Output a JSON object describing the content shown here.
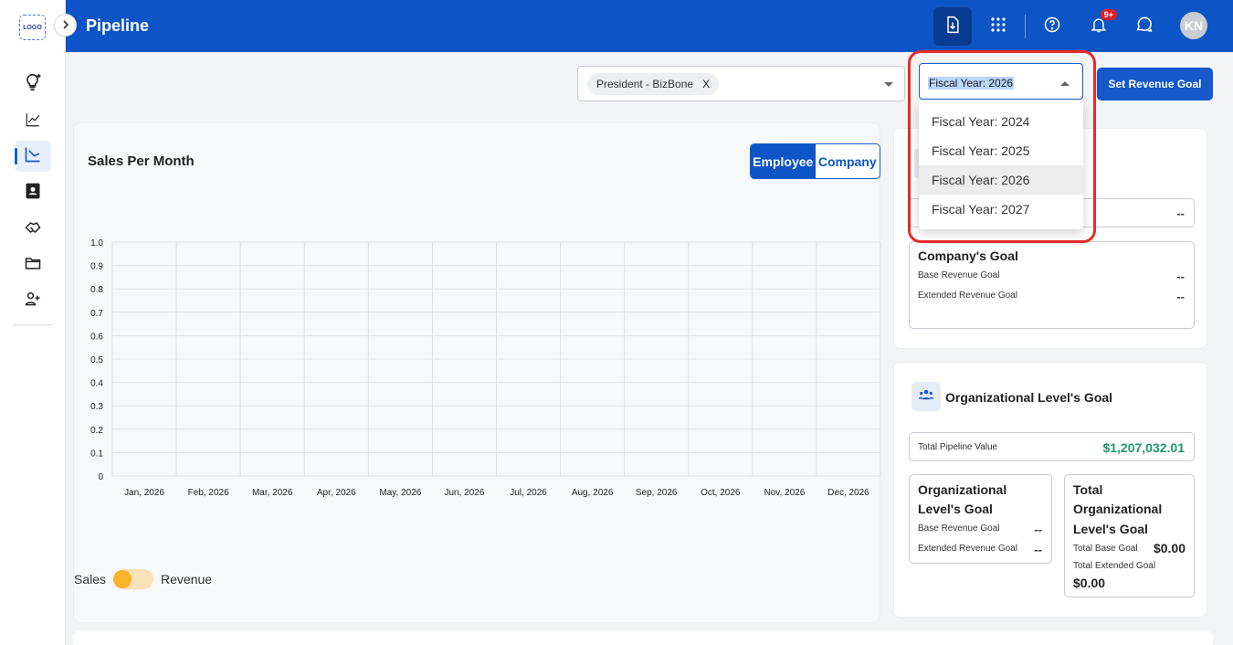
{
  "sidebar": {
    "logo_text": "LOGO",
    "items": [
      {
        "icon": "lightbulb-icon"
      },
      {
        "icon": "trend-line-icon"
      },
      {
        "icon": "pipeline-chart-icon",
        "active": true
      },
      {
        "icon": "contact-book-icon"
      },
      {
        "icon": "handshake-icon"
      },
      {
        "icon": "folder-icon"
      },
      {
        "icon": "add-user-icon"
      }
    ]
  },
  "header": {
    "title": "Pipeline",
    "notification_badge": "9+",
    "avatar_initials": "KN"
  },
  "filters": {
    "selected_chip": "President - BizBone",
    "chip_remove": "X",
    "fiscal_year_value": "Fiscal Year: 2026",
    "set_goal_label": "Set Revenue Goal"
  },
  "fiscal_dropdown": {
    "options": [
      "Fiscal Year: 2024",
      "Fiscal Year: 2025",
      "Fiscal Year: 2026",
      "Fiscal Year: 2027"
    ],
    "selected": "Fiscal Year: 2026"
  },
  "chart_card": {
    "title": "Sales Per Month",
    "view_tabs": [
      "Employee",
      "Company"
    ],
    "active_tab": "Employee",
    "toggle_left": "Sales",
    "toggle_right": "Revenue"
  },
  "chart_data": {
    "type": "bar",
    "title": "Sales Per Month",
    "categories": [
      "Jan, 2026",
      "Feb, 2026",
      "Mar, 2026",
      "Apr, 2026",
      "May, 2026",
      "Jun, 2026",
      "Jul, 2026",
      "Aug, 2026",
      "Sep, 2026",
      "Oct, 2026",
      "Nov, 2026",
      "Dec, 2026"
    ],
    "values": [
      0,
      0,
      0,
      0,
      0,
      0,
      0,
      0,
      0,
      0,
      0,
      0
    ],
    "y_ticks": [
      "0",
      "0.1",
      "0.2",
      "0.3",
      "0.4",
      "0.5",
      "0.6",
      "0.7",
      "0.8",
      "0.9",
      "1.0"
    ],
    "ylim": [
      0,
      1
    ],
    "grid": true
  },
  "company_goal_card": {
    "top_value": "--",
    "title": "Company's Goal",
    "base_label": "Base Revenue Goal",
    "base_value": "--",
    "extended_label": "Extended Revenue Goal",
    "extended_value": "--"
  },
  "org_card": {
    "title": "Organizational Level's Goal",
    "pipeline_label": "Total Pipeline Value",
    "pipeline_value": "$1,207,032.01",
    "left_box": {
      "title_line1": "Organizational",
      "title_line2": "Level's Goal",
      "base_label": "Base Revenue Goal",
      "base_value": "--",
      "extended_label": "Extended Revenue Goal",
      "extended_value": "--"
    },
    "right_box": {
      "title_line1": "Total",
      "title_line2": "Organizational",
      "title_line3": "Level's Goal",
      "base_label": "Total Base Goal",
      "base_value": "$0.00",
      "extended_label": "Total Extended Goal",
      "extended_value": "$0.00"
    }
  },
  "colors": {
    "header": "#0d55c6",
    "primary": "#1558c9",
    "accent_green": "#1c9a6c",
    "highlight": "#e62b2b",
    "toggle_knob": "#f9b52a"
  }
}
